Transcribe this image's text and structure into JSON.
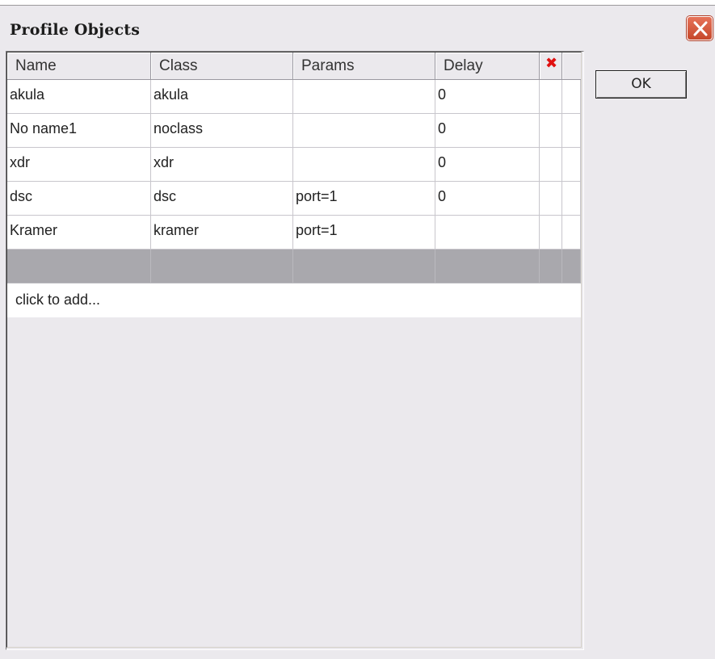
{
  "window": {
    "title": "Profile Objects",
    "close_icon": "close-icon"
  },
  "grid": {
    "columns": [
      "Name",
      "Class",
      "Params",
      "Delay"
    ],
    "delete_column_icon": "delete-x-icon",
    "rows": [
      {
        "name": "akula",
        "class": "akula",
        "params": "",
        "delay": "0"
      },
      {
        "name": "No name1",
        "class": "noclass",
        "params": "",
        "delay": "0"
      },
      {
        "name": "xdr",
        "class": "xdr",
        "params": "",
        "delay": "0"
      },
      {
        "name": "dsc",
        "class": "dsc",
        "params": "port=1",
        "delay": "0"
      },
      {
        "name": "Kramer",
        "class": "kramer",
        "params": "port=1",
        "delay": ""
      }
    ],
    "add_row_label": "click to add..."
  },
  "buttons": {
    "ok_label": "OK"
  },
  "colors": {
    "dialog_bg": "#ebe9ed",
    "selected_row": "#a9a8ad",
    "close_button": "#d5573b",
    "delete_icon": "#e01010"
  }
}
